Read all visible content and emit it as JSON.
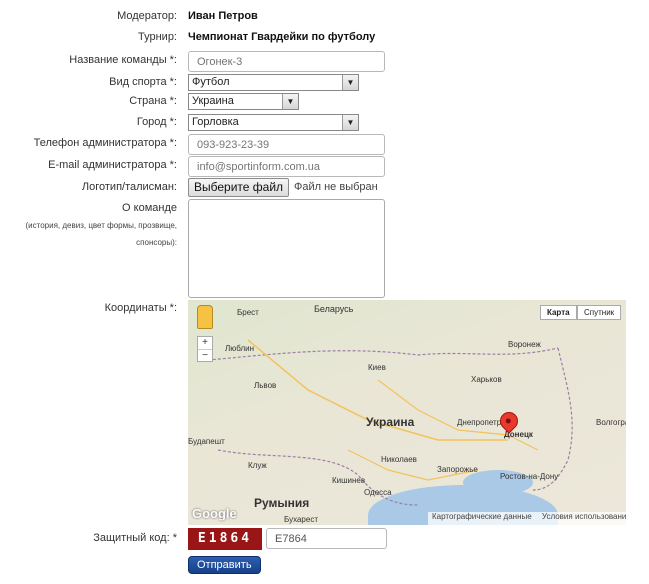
{
  "form": {
    "moderator": {
      "label": "Модератор:",
      "value": "Иван Петров"
    },
    "tournament": {
      "label": "Турнир:",
      "value": "Чемпионат Гвардейки по футболу"
    },
    "team_name": {
      "label": "Название команды *:",
      "value": "",
      "placeholder": "Огонек-3"
    },
    "sport": {
      "label": "Вид спорта *:",
      "value": "Футбол"
    },
    "country": {
      "label": "Страна *:",
      "value": "Украина"
    },
    "city": {
      "label": "Город *:",
      "value": "Горловка"
    },
    "phone": {
      "label": "Телефон администратора *:",
      "value": "",
      "placeholder": "093-923-23-39"
    },
    "email": {
      "label": "E-mail администратора *:",
      "value": "",
      "placeholder": "info@sportinform.com.ua"
    },
    "logo": {
      "label": "Логотип/талисман:",
      "button": "Выберите файл",
      "status": "Файл не выбран"
    },
    "about": {
      "label": "О команде",
      "hint": "(история, девиз, цвет формы, прозвище, спонсоры):",
      "value": ""
    },
    "coords": {
      "label": "Координаты *:"
    },
    "captcha": {
      "label": "Защитный код: *",
      "code": "E1864",
      "value": "E7864"
    },
    "submit": "Отправить"
  },
  "map": {
    "type_map": "Карта",
    "type_sat": "Спутник",
    "zoom_in": "+",
    "zoom_out": "−",
    "pegman": "pegman-icon",
    "brand": "Google",
    "data_credit": "Картографические данные",
    "terms": "Условия использования",
    "labels": {
      "belarus": "Беларусь",
      "ukraine": "Украина",
      "romania": "Румыния",
      "lublin": "Люблин",
      "lviv": "Львов",
      "kiev": "Киев",
      "kharkov": "Харьков",
      "voronezh": "Воронеж",
      "dnepropetrovsk": "Днепропетровск",
      "donetsk": "Донецк",
      "volgograd": "Волгоград",
      "rostov": "Ростов-на-Дону",
      "nikolaev": "Николаев",
      "odessa": "Одесса",
      "zaporozhye": "Запорожье",
      "kishinev": "Кишинев",
      "cluj": "Клуж",
      "budapest": "Будапешт",
      "bucharest": "Бухарест",
      "brest": "Брест"
    }
  }
}
